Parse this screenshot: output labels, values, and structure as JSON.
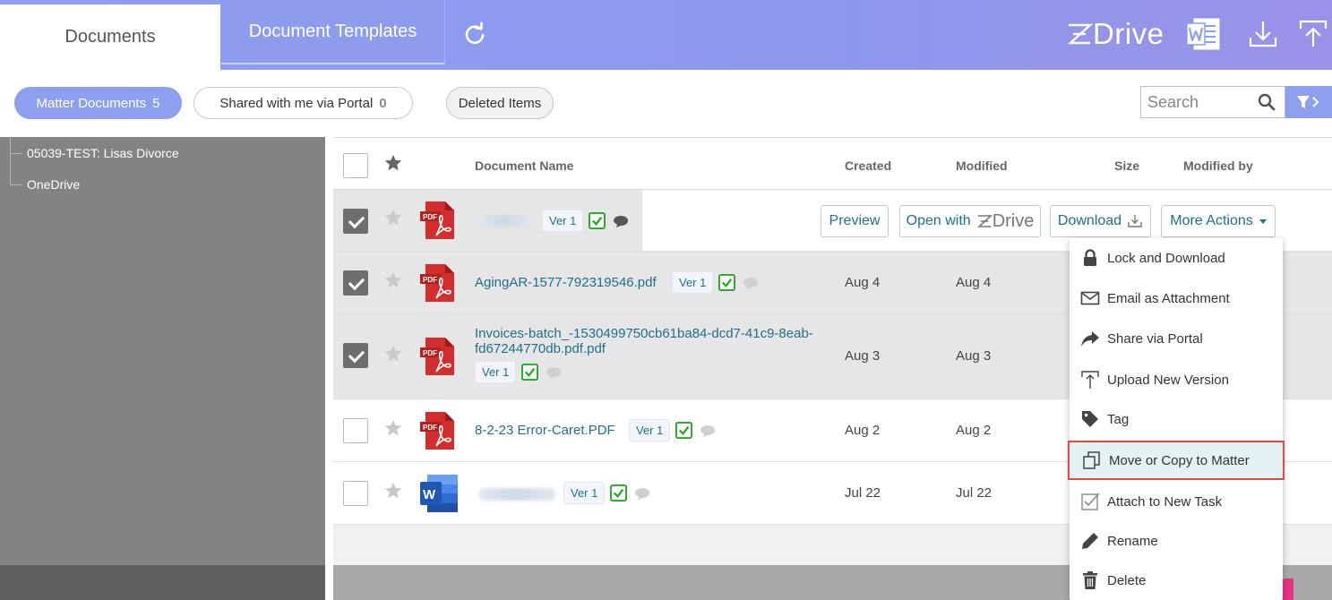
{
  "header": {
    "tabs": [
      {
        "label": "Documents",
        "active": true
      },
      {
        "label": "Document Templates",
        "active": false
      }
    ],
    "logo_text": "Drive",
    "icons": [
      "refresh-icon",
      "word-icon",
      "download-icon",
      "upload-icon"
    ]
  },
  "filters": {
    "matter_documents": {
      "label": "Matter Documents",
      "count": "5"
    },
    "shared_portal": {
      "label": "Shared with me via Portal",
      "count": "0"
    },
    "deleted_items": {
      "label": "Deleted Items"
    },
    "search_placeholder": "Search"
  },
  "tree": {
    "items": [
      {
        "label": "05039-TEST: Lisas Divorce"
      },
      {
        "label": "OneDrive"
      }
    ]
  },
  "table": {
    "columns": {
      "name": "Document Name",
      "created": "Created",
      "modified": "Modified",
      "size": "Size",
      "modified_by": "Modified by"
    },
    "rows": [
      {
        "name": "",
        "name_line1": "",
        "name_line2": "",
        "version": "Ver 1",
        "created": "",
        "modified": "",
        "type": "pdf",
        "checked": true
      },
      {
        "name": "AgingAR-1577-792319546.pdf",
        "version": "Ver 1",
        "created": "Aug 4",
        "modified": "Aug 4",
        "type": "pdf",
        "checked": true
      },
      {
        "name_line1": "Invoices-batch_-1530499750cb61ba84-dcd7-41c9-8eab-",
        "name_line2": "fd67244770db.pdf.pdf",
        "version": "Ver 1",
        "created": "Aug 3",
        "modified": "Aug 3",
        "type": "pdf",
        "checked": true
      },
      {
        "name": "8-2-23 Error-Caret.PDF",
        "version": "Ver 1",
        "created": "Aug 2",
        "modified": "Aug 2",
        "type": "pdf",
        "checked": false
      },
      {
        "name": "",
        "version": "Ver 1",
        "created": "Jul 22",
        "modified": "Jul 22",
        "type": "word",
        "checked": false
      }
    ]
  },
  "row_actions": {
    "preview": "Preview",
    "open_with": "Open with",
    "open_with_logo": "Drive",
    "download": "Download",
    "more_actions": "More Actions"
  },
  "more_actions_menu": {
    "items": [
      {
        "label": "Lock and Download",
        "icon": "lock-icon"
      },
      {
        "label": "Email as Attachment",
        "icon": "envelope-icon"
      },
      {
        "label": "Share via Portal",
        "icon": "share-arrow-icon"
      },
      {
        "label": "Upload New Version",
        "icon": "upload-icon"
      },
      {
        "label": "Tag",
        "icon": "tag-icon"
      },
      {
        "label": "Move or Copy to Matter",
        "icon": "copy-icon",
        "highlighted": true
      },
      {
        "label": "Attach to New Task",
        "icon": "task-check-icon"
      },
      {
        "label": "Rename",
        "icon": "pencil-icon"
      },
      {
        "label": "Delete",
        "icon": "trash-icon"
      }
    ]
  },
  "colors": {
    "header_accent": "#8e9ff0",
    "link": "#1f6f8b",
    "check_green": "#22a822",
    "pdf_red": "#d32d2d",
    "word_blue": "#2b5fb4",
    "highlight_border": "#e04a3f"
  }
}
